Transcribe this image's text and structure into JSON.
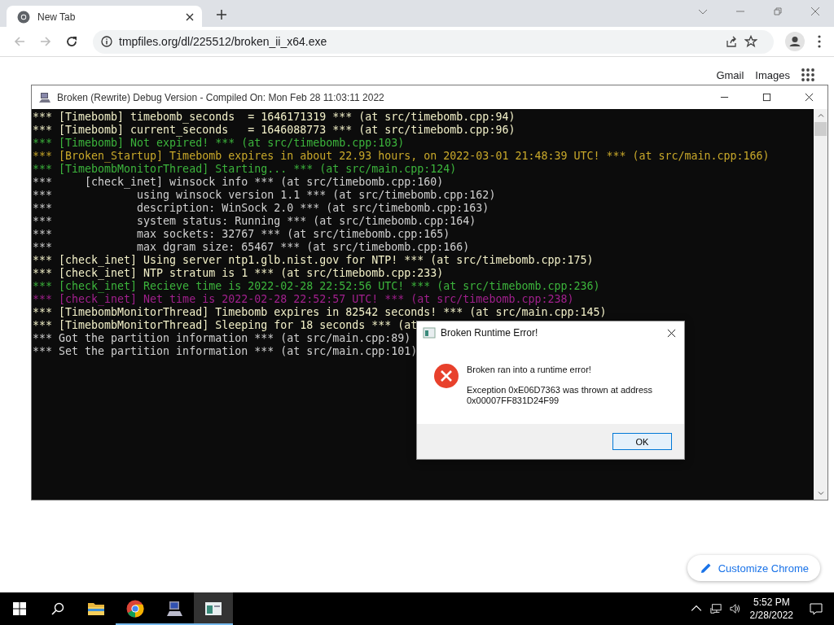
{
  "browser": {
    "tab": {
      "title": "New Tab"
    },
    "url": "tmpfiles.org/dl/225512/broken_ii_x64.exe",
    "links": [
      "Gmail",
      "Images"
    ],
    "customize_button": "Customize Chrome"
  },
  "console_window": {
    "title": "Broken (Rewrite) Debug Version - Compiled On: Mon Feb 28 11:03:11 2022",
    "lines": [
      {
        "text": "*** [Timebomb] timebomb_seconds  = 1646171319 *** (at src/timebomb.cpp:94)",
        "color": "#f2f0c8"
      },
      {
        "text": "*** [Timebomb] current_seconds   = 1646088773 *** (at src/timebomb.cpp:96)",
        "color": "#f2f0c8"
      },
      {
        "text": "*** [Timebomb] Not expired! *** (at src/timebomb.cpp:103)",
        "color": "#3cb43c"
      },
      {
        "text": "*** [Broken_Startup] Timebomb expires in about 22.93 hours, on 2022-03-01 21:48:39 UTC! *** (at src/main.cpp:166)",
        "color": "#c8a82a"
      },
      {
        "text": "*** [TimebombMonitorThread] Starting... *** (at src/main.cpp:124)",
        "color": "#3cb43c"
      },
      {
        "text": "***     [check_inet] winsock info *** (at src/timebomb.cpp:160)",
        "color": "#d0d0d0"
      },
      {
        "text": "***             using winsock version 1.1 *** (at src/timebomb.cpp:162)",
        "color": "#d0d0d0"
      },
      {
        "text": "***             description: WinSock 2.0 *** (at src/timebomb.cpp:163)",
        "color": "#d0d0d0"
      },
      {
        "text": "***             system status: Running *** (at src/timebomb.cpp:164)",
        "color": "#d0d0d0"
      },
      {
        "text": "***             max sockets: 32767 *** (at src/timebomb.cpp:165)",
        "color": "#d0d0d0"
      },
      {
        "text": "***             max dgram size: 65467 *** (at src/timebomb.cpp:166)",
        "color": "#d0d0d0"
      },
      {
        "text": "*** [check_inet] Using server ntp1.glb.nist.gov for NTP! *** (at src/timebomb.cpp:175)",
        "color": "#f2f0c8"
      },
      {
        "text": "*** [check_inet] NTP stratum is 1 *** (at src/timebomb.cpp:233)",
        "color": "#f2f0c8"
      },
      {
        "text": "*** [check_inet] Recieve time is 2022-02-28 22:52:56 UTC! *** (at src/timebomb.cpp:236)",
        "color": "#3cb43c"
      },
      {
        "text": "*** [check_inet] Net time is 2022-02-28 22:52:57 UTC! *** (at src/timebomb.cpp:238)",
        "color": "#a0208c"
      },
      {
        "text": "*** [TimebombMonitorThread] Timebomb expires in 82542 seconds! *** (at src/main.cpp:145)",
        "color": "#f2f0c8"
      },
      {
        "text": "*** [TimebombMonitorThread] Sleeping for 18 seconds *** (at",
        "color": "#f2f0c8"
      },
      {
        "text": "*** Got the partition information *** (at src/main.cpp:89)",
        "color": "#d0d0d0"
      },
      {
        "text": "*** Set the partition information *** (at src/main.cpp:101)",
        "color": "#d0d0d0"
      }
    ],
    "dialog": {
      "title": "Broken Runtime Error!",
      "message": "Broken ran into a runtime error!",
      "detail": "Exception 0xE06D7363 was thrown at address 0x00007FF831D24F99",
      "button": "OK"
    }
  },
  "taskbar": {
    "apps": [
      {
        "kind": "explorer",
        "running": false,
        "active": false
      },
      {
        "kind": "chrome",
        "running": true,
        "active": false
      },
      {
        "kind": "computer",
        "running": true,
        "active": false
      },
      {
        "kind": "console",
        "running": true,
        "active": true
      }
    ],
    "time": "5:52 PM",
    "date": "2/28/2022"
  }
}
